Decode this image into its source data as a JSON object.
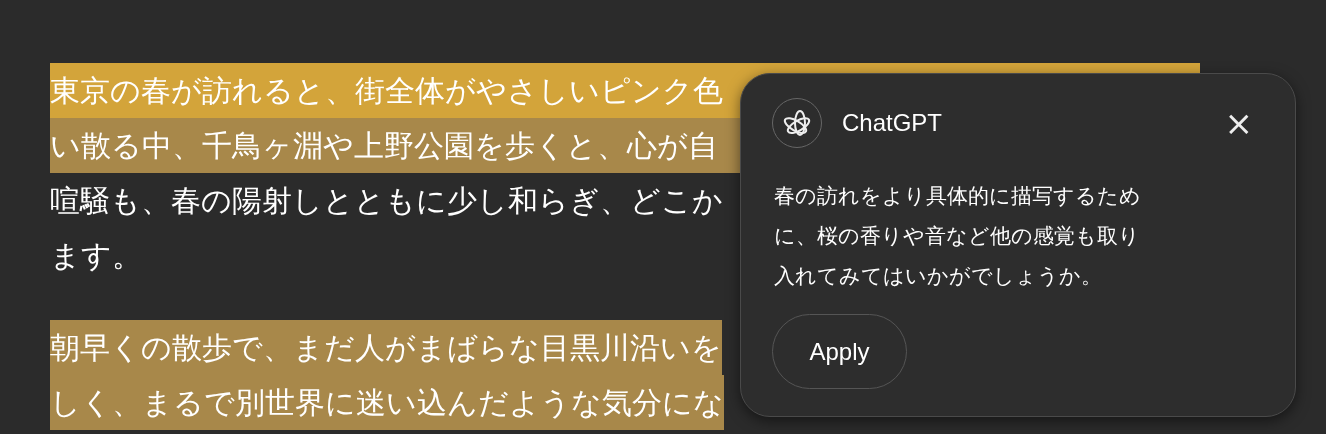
{
  "document": {
    "paragraphs": [
      {
        "lines": [
          {
            "text": "東京の春が訪れると、街全体がやさしいピンク色",
            "highlighted": true,
            "color": "#d3a43a"
          },
          {
            "text": "い散る中、千鳥ヶ淵や上野公園を歩くと、心が自",
            "highlighted": true,
            "color": "#a8884a"
          },
          {
            "text": "喧騒も、春の陽射しとともに少し和らぎ、どこか",
            "highlighted": false
          },
          {
            "text": "ます。",
            "highlighted": false
          }
        ]
      },
      {
        "lines": [
          {
            "text": "朝早くの散歩で、まだ人がまばらな目黒川沿いを",
            "highlighted": true,
            "color": "#a8884a"
          },
          {
            "text": "しく、まるで別世界に迷い込んだような気分にな",
            "highlighted": true,
            "color": "#a8884a"
          }
        ]
      }
    ]
  },
  "suggestion_popup": {
    "title": "ChatGPT",
    "close": "×",
    "message": "春の訪れをより具体的に描写するために、桜の香りや音など他の感覚も取り入れてみてはいかがでしょうか。",
    "apply_button": "Apply"
  }
}
